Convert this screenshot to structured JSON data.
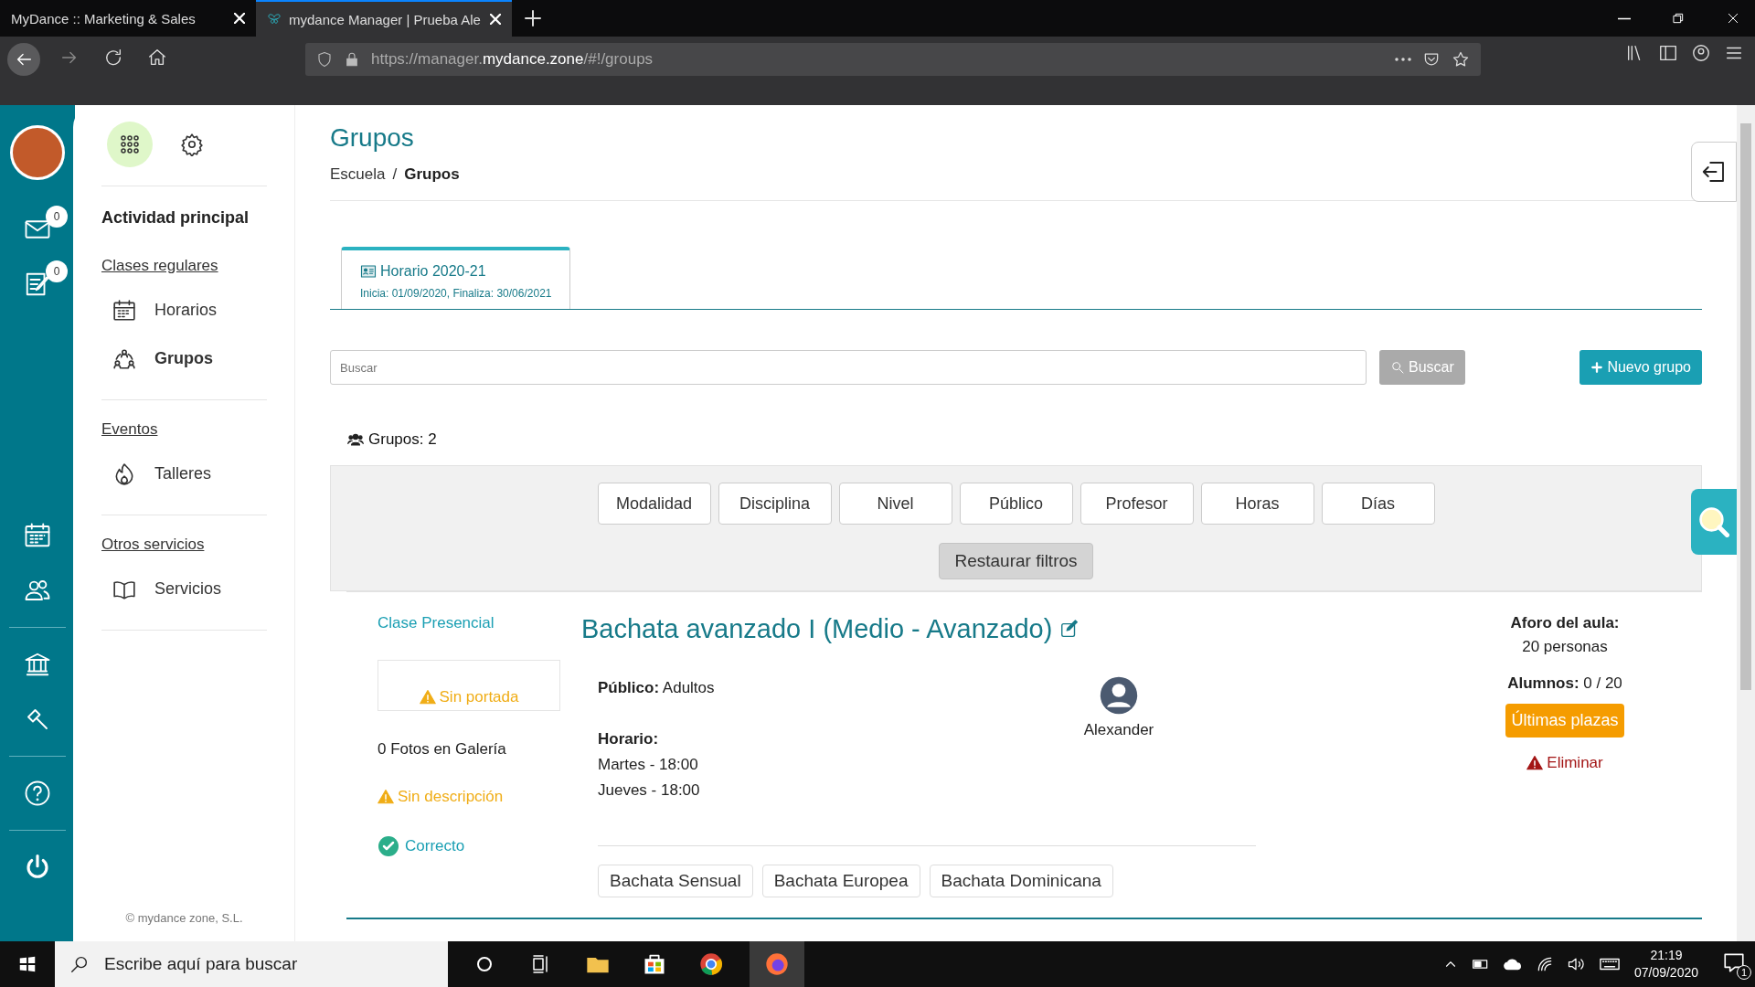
{
  "browser": {
    "tabs": [
      {
        "title": "MyDance :: Marketing & Sales",
        "selected": false
      },
      {
        "title": "mydance Manager | Prueba Ale",
        "selected": true
      }
    ],
    "url": {
      "prefix": "https://manager.",
      "domain": "mydance.zone",
      "path": "/#!/groups"
    }
  },
  "rail": {
    "top": [
      {
        "kind": "mail",
        "count": "0"
      },
      {
        "kind": "notes",
        "count": "0"
      }
    ],
    "bottom": [
      {
        "kind": "calendar"
      },
      {
        "kind": "people"
      },
      {
        "kind": "divider"
      },
      {
        "kind": "bank"
      },
      {
        "kind": "hammer"
      },
      {
        "kind": "divider"
      },
      {
        "kind": "help"
      },
      {
        "kind": "divider"
      },
      {
        "kind": "power"
      }
    ]
  },
  "nav": {
    "title": "Actividad principal",
    "sections": [
      {
        "heading": "Clases regulares",
        "items": [
          {
            "label": "Horarios",
            "kind": "calendar",
            "selected": false
          },
          {
            "label": "Grupos",
            "kind": "group",
            "selected": true
          }
        ]
      },
      {
        "heading": "Eventos",
        "items": [
          {
            "label": "Talleres",
            "kind": "flame",
            "selected": false
          }
        ]
      },
      {
        "heading": "Otros servicios",
        "items": [
          {
            "label": "Servicios",
            "kind": "book",
            "selected": false
          }
        ]
      }
    ],
    "footer": "© mydance zone, S.L."
  },
  "page": {
    "title": "Grupos",
    "breadcrumb": [
      "Escuela",
      "Grupos"
    ],
    "breadcrumb_separator": "/",
    "schedule_tabs": [
      {
        "title": "Horario 2020-21",
        "dates": "Inicia: 01/09/2020, Finaliza: 30/06/2021",
        "selected": true
      }
    ],
    "search": {
      "placeholder": "Buscar",
      "button": "Buscar"
    },
    "new_button": "Nuevo grupo",
    "count": "Grupos: 2",
    "filters": [
      "Modalidad",
      "Disciplina",
      "Nivel",
      "Público",
      "Profesor",
      "Horas",
      "Días"
    ],
    "reset": "Restaurar filtros",
    "cards": [
      {
        "modality": "Clase Presencial",
        "cover": "Sin portada",
        "photos": "0 Fotos en Galería",
        "description": "Sin descripción",
        "status": "Correcto",
        "title": "Bachata avanzado I (Medio - Avanzado)",
        "audience": "**Público:** Adultos",
        "schedule_label": "Horario:",
        "times": [
          "Martes - 18:00",
          "Jueves - 18:00"
        ],
        "teacher": "Alexander",
        "capacity_label": "Aforo del aula:",
        "capacity": "20 personas",
        "students": "**Alumnos:** 0 / 20",
        "badge": "Últimas plazas",
        "delete": "Eliminar",
        "tags": [
          "Bachata Sensual",
          "Bachata Europea",
          "Bachata Dominicana"
        ]
      }
    ]
  },
  "taskbar": {
    "search_placeholder": "Escribe aquí para buscar",
    "time": "21:19",
    "date": "07/09/2020",
    "notifications": "1"
  }
}
